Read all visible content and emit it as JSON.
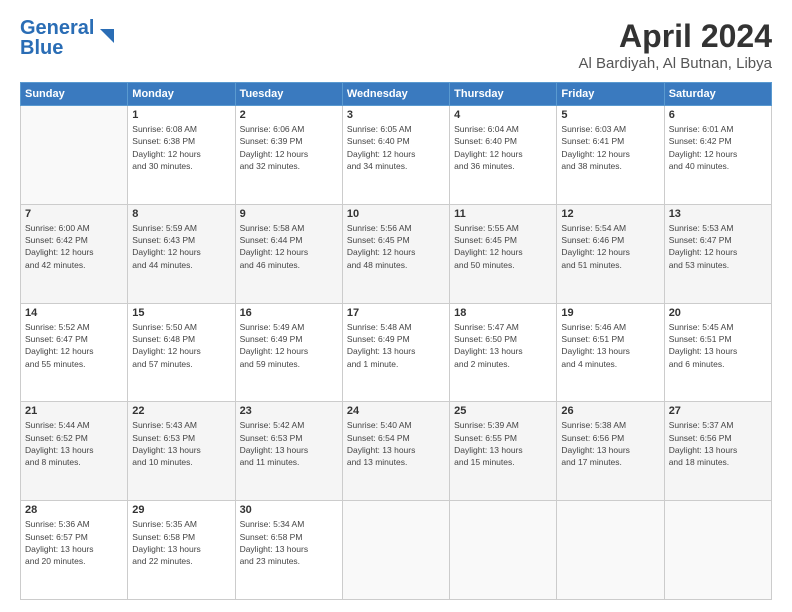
{
  "logo": {
    "line1": "General",
    "line2": "Blue"
  },
  "title": "April 2024",
  "subtitle": "Al Bardiyah, Al Butnan, Libya",
  "days_of_week": [
    "Sunday",
    "Monday",
    "Tuesday",
    "Wednesday",
    "Thursday",
    "Friday",
    "Saturday"
  ],
  "weeks": [
    [
      {
        "day": "",
        "info": ""
      },
      {
        "day": "1",
        "info": "Sunrise: 6:08 AM\nSunset: 6:38 PM\nDaylight: 12 hours\nand 30 minutes."
      },
      {
        "day": "2",
        "info": "Sunrise: 6:06 AM\nSunset: 6:39 PM\nDaylight: 12 hours\nand 32 minutes."
      },
      {
        "day": "3",
        "info": "Sunrise: 6:05 AM\nSunset: 6:40 PM\nDaylight: 12 hours\nand 34 minutes."
      },
      {
        "day": "4",
        "info": "Sunrise: 6:04 AM\nSunset: 6:40 PM\nDaylight: 12 hours\nand 36 minutes."
      },
      {
        "day": "5",
        "info": "Sunrise: 6:03 AM\nSunset: 6:41 PM\nDaylight: 12 hours\nand 38 minutes."
      },
      {
        "day": "6",
        "info": "Sunrise: 6:01 AM\nSunset: 6:42 PM\nDaylight: 12 hours\nand 40 minutes."
      }
    ],
    [
      {
        "day": "7",
        "info": "Sunrise: 6:00 AM\nSunset: 6:42 PM\nDaylight: 12 hours\nand 42 minutes."
      },
      {
        "day": "8",
        "info": "Sunrise: 5:59 AM\nSunset: 6:43 PM\nDaylight: 12 hours\nand 44 minutes."
      },
      {
        "day": "9",
        "info": "Sunrise: 5:58 AM\nSunset: 6:44 PM\nDaylight: 12 hours\nand 46 minutes."
      },
      {
        "day": "10",
        "info": "Sunrise: 5:56 AM\nSunset: 6:45 PM\nDaylight: 12 hours\nand 48 minutes."
      },
      {
        "day": "11",
        "info": "Sunrise: 5:55 AM\nSunset: 6:45 PM\nDaylight: 12 hours\nand 50 minutes."
      },
      {
        "day": "12",
        "info": "Sunrise: 5:54 AM\nSunset: 6:46 PM\nDaylight: 12 hours\nand 51 minutes."
      },
      {
        "day": "13",
        "info": "Sunrise: 5:53 AM\nSunset: 6:47 PM\nDaylight: 12 hours\nand 53 minutes."
      }
    ],
    [
      {
        "day": "14",
        "info": "Sunrise: 5:52 AM\nSunset: 6:47 PM\nDaylight: 12 hours\nand 55 minutes."
      },
      {
        "day": "15",
        "info": "Sunrise: 5:50 AM\nSunset: 6:48 PM\nDaylight: 12 hours\nand 57 minutes."
      },
      {
        "day": "16",
        "info": "Sunrise: 5:49 AM\nSunset: 6:49 PM\nDaylight: 12 hours\nand 59 minutes."
      },
      {
        "day": "17",
        "info": "Sunrise: 5:48 AM\nSunset: 6:49 PM\nDaylight: 13 hours\nand 1 minute."
      },
      {
        "day": "18",
        "info": "Sunrise: 5:47 AM\nSunset: 6:50 PM\nDaylight: 13 hours\nand 2 minutes."
      },
      {
        "day": "19",
        "info": "Sunrise: 5:46 AM\nSunset: 6:51 PM\nDaylight: 13 hours\nand 4 minutes."
      },
      {
        "day": "20",
        "info": "Sunrise: 5:45 AM\nSunset: 6:51 PM\nDaylight: 13 hours\nand 6 minutes."
      }
    ],
    [
      {
        "day": "21",
        "info": "Sunrise: 5:44 AM\nSunset: 6:52 PM\nDaylight: 13 hours\nand 8 minutes."
      },
      {
        "day": "22",
        "info": "Sunrise: 5:43 AM\nSunset: 6:53 PM\nDaylight: 13 hours\nand 10 minutes."
      },
      {
        "day": "23",
        "info": "Sunrise: 5:42 AM\nSunset: 6:53 PM\nDaylight: 13 hours\nand 11 minutes."
      },
      {
        "day": "24",
        "info": "Sunrise: 5:40 AM\nSunset: 6:54 PM\nDaylight: 13 hours\nand 13 minutes."
      },
      {
        "day": "25",
        "info": "Sunrise: 5:39 AM\nSunset: 6:55 PM\nDaylight: 13 hours\nand 15 minutes."
      },
      {
        "day": "26",
        "info": "Sunrise: 5:38 AM\nSunset: 6:56 PM\nDaylight: 13 hours\nand 17 minutes."
      },
      {
        "day": "27",
        "info": "Sunrise: 5:37 AM\nSunset: 6:56 PM\nDaylight: 13 hours\nand 18 minutes."
      }
    ],
    [
      {
        "day": "28",
        "info": "Sunrise: 5:36 AM\nSunset: 6:57 PM\nDaylight: 13 hours\nand 20 minutes."
      },
      {
        "day": "29",
        "info": "Sunrise: 5:35 AM\nSunset: 6:58 PM\nDaylight: 13 hours\nand 22 minutes."
      },
      {
        "day": "30",
        "info": "Sunrise: 5:34 AM\nSunset: 6:58 PM\nDaylight: 13 hours\nand 23 minutes."
      },
      {
        "day": "",
        "info": ""
      },
      {
        "day": "",
        "info": ""
      },
      {
        "day": "",
        "info": ""
      },
      {
        "day": "",
        "info": ""
      }
    ]
  ]
}
